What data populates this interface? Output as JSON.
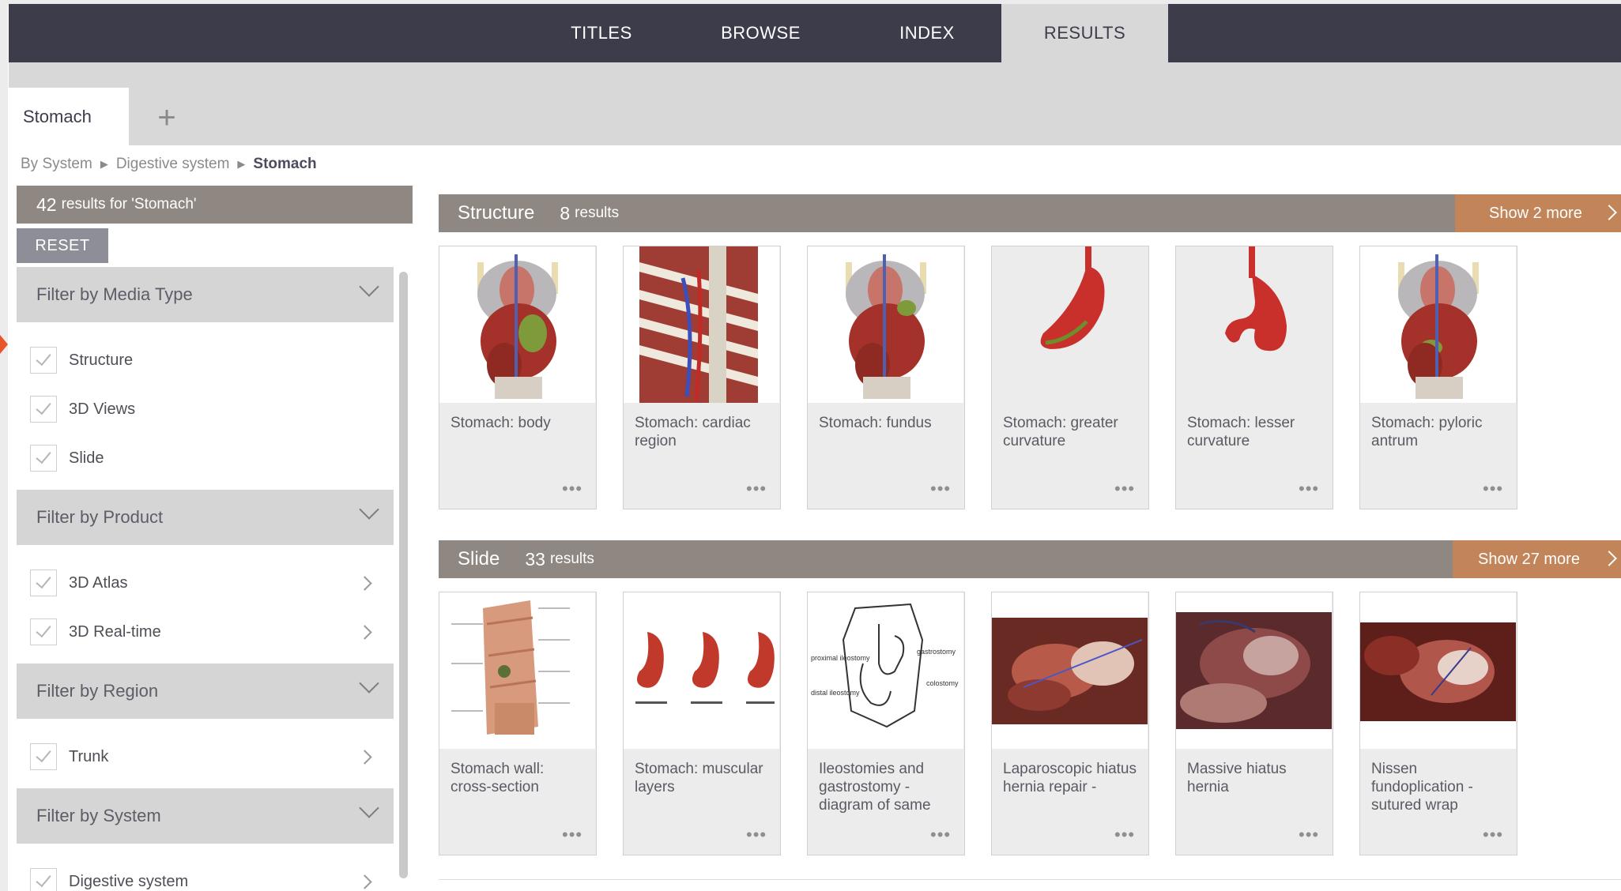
{
  "nav": {
    "tabs": [
      {
        "label": "TITLES"
      },
      {
        "label": "BROWSE"
      },
      {
        "label": "INDEX"
      },
      {
        "label": "RESULTS",
        "active": true
      }
    ]
  },
  "search_tabs": {
    "current": "Stomach",
    "add_symbol": "+"
  },
  "breadcrumb": {
    "items": [
      "By System",
      "Digestive system",
      "Stomach"
    ],
    "separator": "▶"
  },
  "results_summary": {
    "count": "42",
    "text": "results for 'Stomach'"
  },
  "reset_label": "RESET",
  "filters": {
    "media_type": {
      "header": "Filter by Media Type",
      "options": [
        {
          "label": "Structure",
          "checked": true
        },
        {
          "label": "3D Views",
          "checked": true
        },
        {
          "label": "Slide",
          "checked": true
        }
      ]
    },
    "product": {
      "header": "Filter by Product",
      "options": [
        {
          "label": "3D Atlas",
          "checked": true
        },
        {
          "label": "3D Real-time",
          "checked": true
        }
      ]
    },
    "region": {
      "header": "Filter by Region",
      "options": [
        {
          "label": "Trunk",
          "checked": true
        }
      ]
    },
    "system": {
      "header": "Filter by System",
      "options": [
        {
          "label": "Digestive system",
          "checked": true
        }
      ]
    }
  },
  "sections": {
    "structure": {
      "title": "Structure",
      "count": "8",
      "count_label": "results",
      "show_more": "Show 2 more",
      "items": [
        {
          "caption": "Stomach: body",
          "icon": "torso-anatomy-thumbnail"
        },
        {
          "caption": "Stomach: cardiac region",
          "icon": "ribcage-anatomy-thumbnail"
        },
        {
          "caption": "Stomach: fundus",
          "icon": "torso-anatomy-thumbnail"
        },
        {
          "caption": "Stomach: greater curvature",
          "icon": "stomach-thumbnail"
        },
        {
          "caption": "Stomach: lesser curvature",
          "icon": "stomach-thumbnail"
        },
        {
          "caption": "Stomach: pyloric antrum",
          "icon": "torso-anatomy-thumbnail"
        }
      ]
    },
    "slide": {
      "title": "Slide",
      "count": "33",
      "count_label": "results",
      "show_more": "Show 27 more",
      "items": [
        {
          "caption": "Stomach wall: cross-section",
          "icon": "stomach-wall-diagram-thumbnail"
        },
        {
          "caption": "Stomach: muscular layers",
          "icon": "stomach-layers-thumbnail"
        },
        {
          "caption": "Ileostomies and gastrostomy - diagram of same",
          "icon": "ileostomy-diagram-thumbnail",
          "diagram_labels": [
            "proximal ileostomy",
            "distal ileostomy",
            "gastrostomy",
            "colostomy"
          ]
        },
        {
          "caption": "Laparoscopic hiatus hernia repair -",
          "icon": "surgical-photo-thumbnail"
        },
        {
          "caption": "Massive hiatus hernia",
          "icon": "surgical-photo-thumbnail"
        },
        {
          "caption": "Nissen fundoplication - sutured wrap",
          "icon": "surgical-photo-thumbnail"
        }
      ]
    }
  },
  "card_menu_symbol": "•••",
  "colors": {
    "nav_bg": "#3d3c4a",
    "section_bg": "#8f8781",
    "show_more_bg": "#c2855a",
    "filter_header_bg": "#d5d5d5"
  }
}
